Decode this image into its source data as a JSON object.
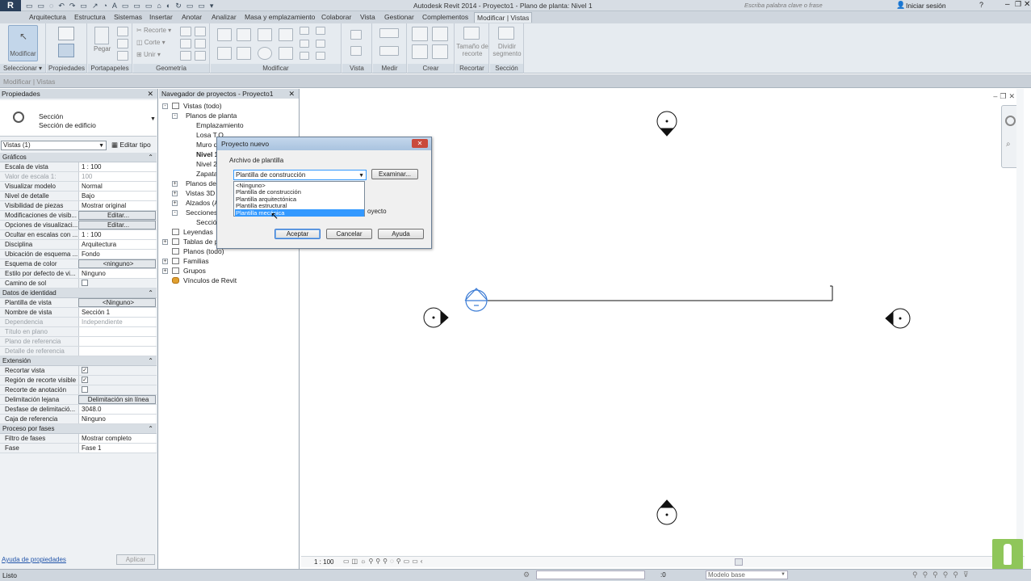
{
  "app": {
    "title": "Autodesk Revit 2014 -    Proyecto1 - Plano de planta: Nivel 1",
    "search_placeholder": "Escriba palabra clave o frase",
    "signin": "Iniciar sesión"
  },
  "menu": [
    "Arquitectura",
    "Estructura",
    "Sistemas",
    "Insertar",
    "Anotar",
    "Analizar",
    "Masa y emplazamiento",
    "Colaborar",
    "Vista",
    "Gestionar",
    "Complementos",
    "Modificar | Vistas"
  ],
  "ribbon": {
    "modify": "Modificar",
    "properties": "Propiedades",
    "paste": "Pegar",
    "recorte": "Recorte",
    "corte": "Corte",
    "unir": "Unir",
    "tamano": "Tamaño de",
    "recorte2": "recorte",
    "dividir": "Dividir",
    "segmento": "segmento",
    "groups": [
      "Seleccionar",
      "Propiedades",
      "Portapapeles",
      "Geometría",
      "Modificar",
      "Vista",
      "Medir",
      "Crear",
      "Recortar",
      "Sección"
    ]
  },
  "context": "Modificar | Vistas",
  "properties": {
    "header": "Propiedades",
    "type_name": "Sección",
    "type_sub": "Sección de edificio",
    "selector": "Vistas (1)",
    "edit_type": "Editar tipo",
    "cat_graphics": "Gráficos",
    "cat_identity": "Datos de identidad",
    "cat_extension": "Extensión",
    "cat_phases": "Proceso por fases",
    "rows_graphics": [
      {
        "k": "Escala de vista",
        "v": "1 : 100"
      },
      {
        "k": "Valor de escala   1:",
        "v": "100"
      },
      {
        "k": "Visualizar modelo",
        "v": "Normal"
      },
      {
        "k": "Nivel de detalle",
        "v": "Bajo"
      },
      {
        "k": "Visibilidad de piezas",
        "v": "Mostrar original"
      },
      {
        "k": "Modificaciones de visib...",
        "v": "Editar..."
      },
      {
        "k": "Opciones de visualizaci...",
        "v": "Editar..."
      },
      {
        "k": "Ocultar en escalas con ...",
        "v": "1 : 100"
      },
      {
        "k": "Disciplina",
        "v": "Arquitectura"
      },
      {
        "k": "Ubicación de esquema ...",
        "v": "Fondo"
      },
      {
        "k": "Esquema de color",
        "v": "<ninguno>"
      },
      {
        "k": "Estilo por defecto de vi...",
        "v": "Ninguno"
      },
      {
        "k": "Camino de sol",
        "v": ""
      }
    ],
    "rows_identity": [
      {
        "k": "Plantilla de vista",
        "v": "<Ninguno>"
      },
      {
        "k": "Nombre de vista",
        "v": "Sección 1"
      },
      {
        "k": "Dependencia",
        "v": "Independiente"
      },
      {
        "k": "Título en plano",
        "v": ""
      },
      {
        "k": "Plano de referencia",
        "v": ""
      },
      {
        "k": "Detalle de referencia",
        "v": ""
      }
    ],
    "rows_extension": [
      {
        "k": "Recortar vista",
        "v": ""
      },
      {
        "k": "Región de recorte visible",
        "v": ""
      },
      {
        "k": "Recorte de anotación",
        "v": ""
      },
      {
        "k": "Delimitación lejana",
        "v": "Delimitación sin línea"
      },
      {
        "k": "Desfase de delimitació...",
        "v": "3048.0"
      },
      {
        "k": "Caja de referencia",
        "v": "Ninguno"
      }
    ],
    "rows_phases": [
      {
        "k": "Filtro de fases",
        "v": "Mostrar completo"
      },
      {
        "k": "Fase",
        "v": "Fase 1"
      }
    ],
    "help_link": "Ayuda de propiedades",
    "apply": "Aplicar"
  },
  "navigator": {
    "header": "Navegador de proyectos - Proyecto1",
    "items": [
      "Vistas (todo)",
      "Planos de planta",
      "Emplazamiento",
      "Losa T.O.",
      "Muro de",
      "Nivel 1",
      "Nivel 2",
      "Zapata",
      "Planos de t",
      "Vistas 3D",
      "Alzados (Al",
      "Secciones (",
      "Secció",
      "Leyendas",
      "Tablas de pl",
      "Planos (todo)",
      "Familias",
      "Grupos",
      "Vínculos de Revit"
    ]
  },
  "dialog": {
    "title": "Proyecto nuevo",
    "label": "Archivo de plantilla",
    "selected": "Plantilla de construcción",
    "browse": "Examinar...",
    "options": [
      "<Ninguno>",
      "Plantilla de construcción",
      "Plantilla arquitectónica",
      "Plantilla estructural",
      "Plantilla mecánica"
    ],
    "hidden_text": "oyecto",
    "ok": "Aceptar",
    "cancel": "Cancelar",
    "help": "Ayuda"
  },
  "viewbar": {
    "scale": "1 : 100"
  },
  "status": {
    "text": "Listo",
    "zero": ":0",
    "model": "Modelo base"
  }
}
